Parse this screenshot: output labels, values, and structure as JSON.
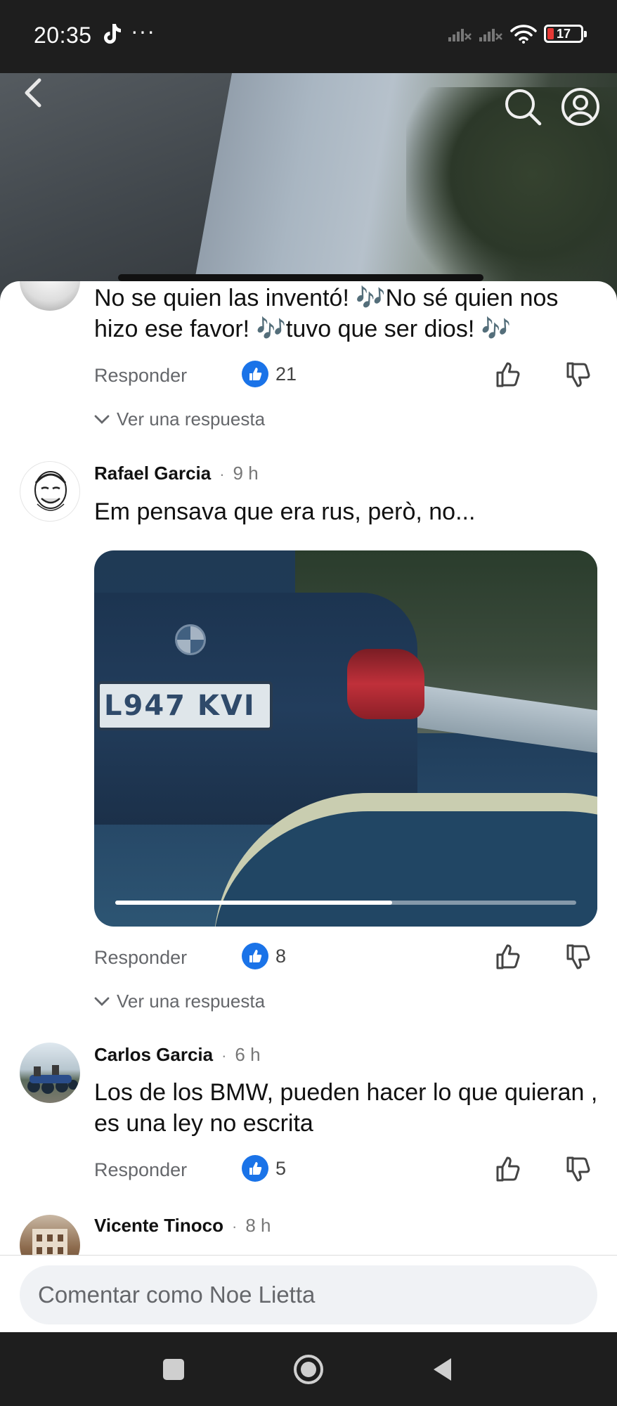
{
  "status_bar": {
    "time": "20:35",
    "dots": "···",
    "battery": "17",
    "battery_level": 0.17
  },
  "header": {
    "back_icon": "chevron-left-icon",
    "search_icon": "search-icon",
    "account_icon": "account-icon"
  },
  "comments": [
    {
      "text": "No se quien las inventó! 🎶No sé quien nos hizo ese favor! 🎶tuvo que ser dios! 🎶",
      "reply_label": "Responder",
      "likes": "21",
      "replies_label": "Ver una respuesta"
    },
    {
      "author": "Rafael Garcia",
      "time": "9 h",
      "text": "Em pensava que era rus, però, no...",
      "video": {
        "plate_text": "L947 KVI",
        "progress": 0.6
      },
      "reply_label": "Responder",
      "likes": "8",
      "replies_label": "Ver una respuesta"
    },
    {
      "author": "Carlos Garcia",
      "time": "6 h",
      "text": "Los de los BMW, pueden hacer lo que quieran , es una ley no escrita",
      "reply_label": "Responder",
      "likes": "5"
    },
    {
      "author": "Vicente Tinoco",
      "time": "8 h"
    }
  ],
  "composer": {
    "placeholder": "Comentar como Noe Lietta"
  },
  "nav": {
    "recents_icon": "square-icon",
    "home_icon": "circle-icon",
    "back_icon": "triangle-back-icon"
  },
  "colors": {
    "like_blue": "#1a73e8",
    "status_bg": "#1e1e1e",
    "muted_text": "#65676b"
  }
}
